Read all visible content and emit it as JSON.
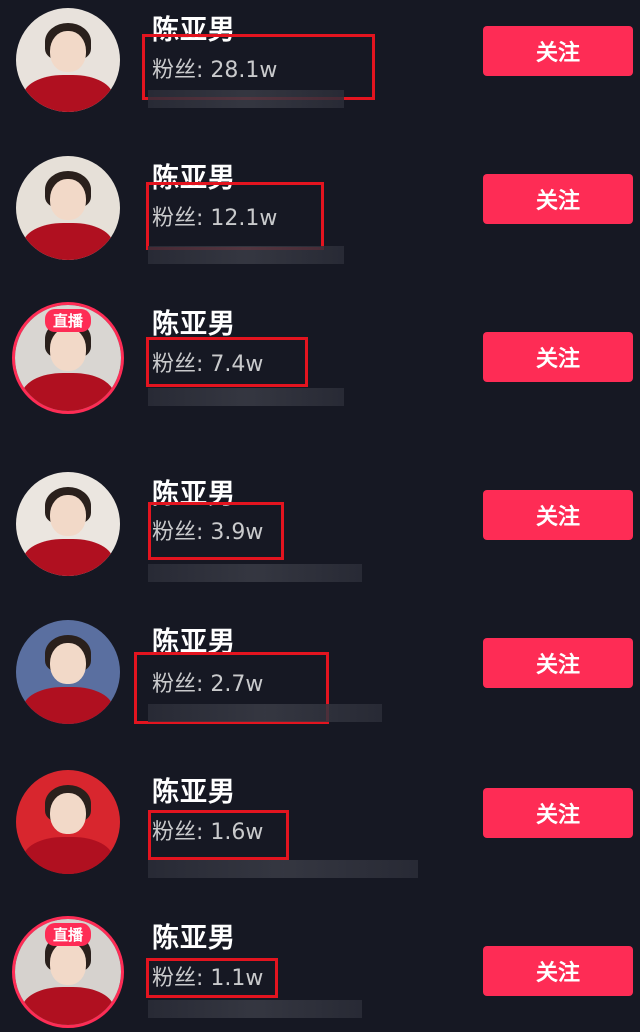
{
  "users": [
    {
      "name": "陈亚男",
      "fans": "粉丝: 28.1w",
      "follow_label": "关注",
      "live": false,
      "live_label": "",
      "bg": "#e8e2dc"
    },
    {
      "name": "陈亚男",
      "fans": "粉丝: 12.1w",
      "follow_label": "关注",
      "live": false,
      "live_label": "",
      "bg": "#e6e0d8"
    },
    {
      "name": "陈亚男",
      "fans": "粉丝: 7.4w",
      "follow_label": "关注",
      "live": true,
      "live_label": "直播",
      "bg": "#d9d6d2"
    },
    {
      "name": "陈亚男",
      "fans": "粉丝: 3.9w",
      "follow_label": "关注",
      "live": false,
      "live_label": "",
      "bg": "#ebe6e0"
    },
    {
      "name": "陈亚男",
      "fans": "粉丝: 2.7w",
      "follow_label": "关注",
      "live": false,
      "live_label": "",
      "bg": "#5a6fa0"
    },
    {
      "name": "陈亚男",
      "fans": "粉丝: 1.6w",
      "follow_label": "关注",
      "live": false,
      "live_label": "",
      "bg": "#d8262e"
    },
    {
      "name": "陈亚男",
      "fans": "粉丝: 1.1w",
      "follow_label": "关注",
      "live": true,
      "live_label": "直播",
      "bg": "#d6d2ce"
    }
  ],
  "colors": {
    "background": "#161823",
    "follow_button": "#fe2c55",
    "highlight_box": "#e3141f"
  }
}
